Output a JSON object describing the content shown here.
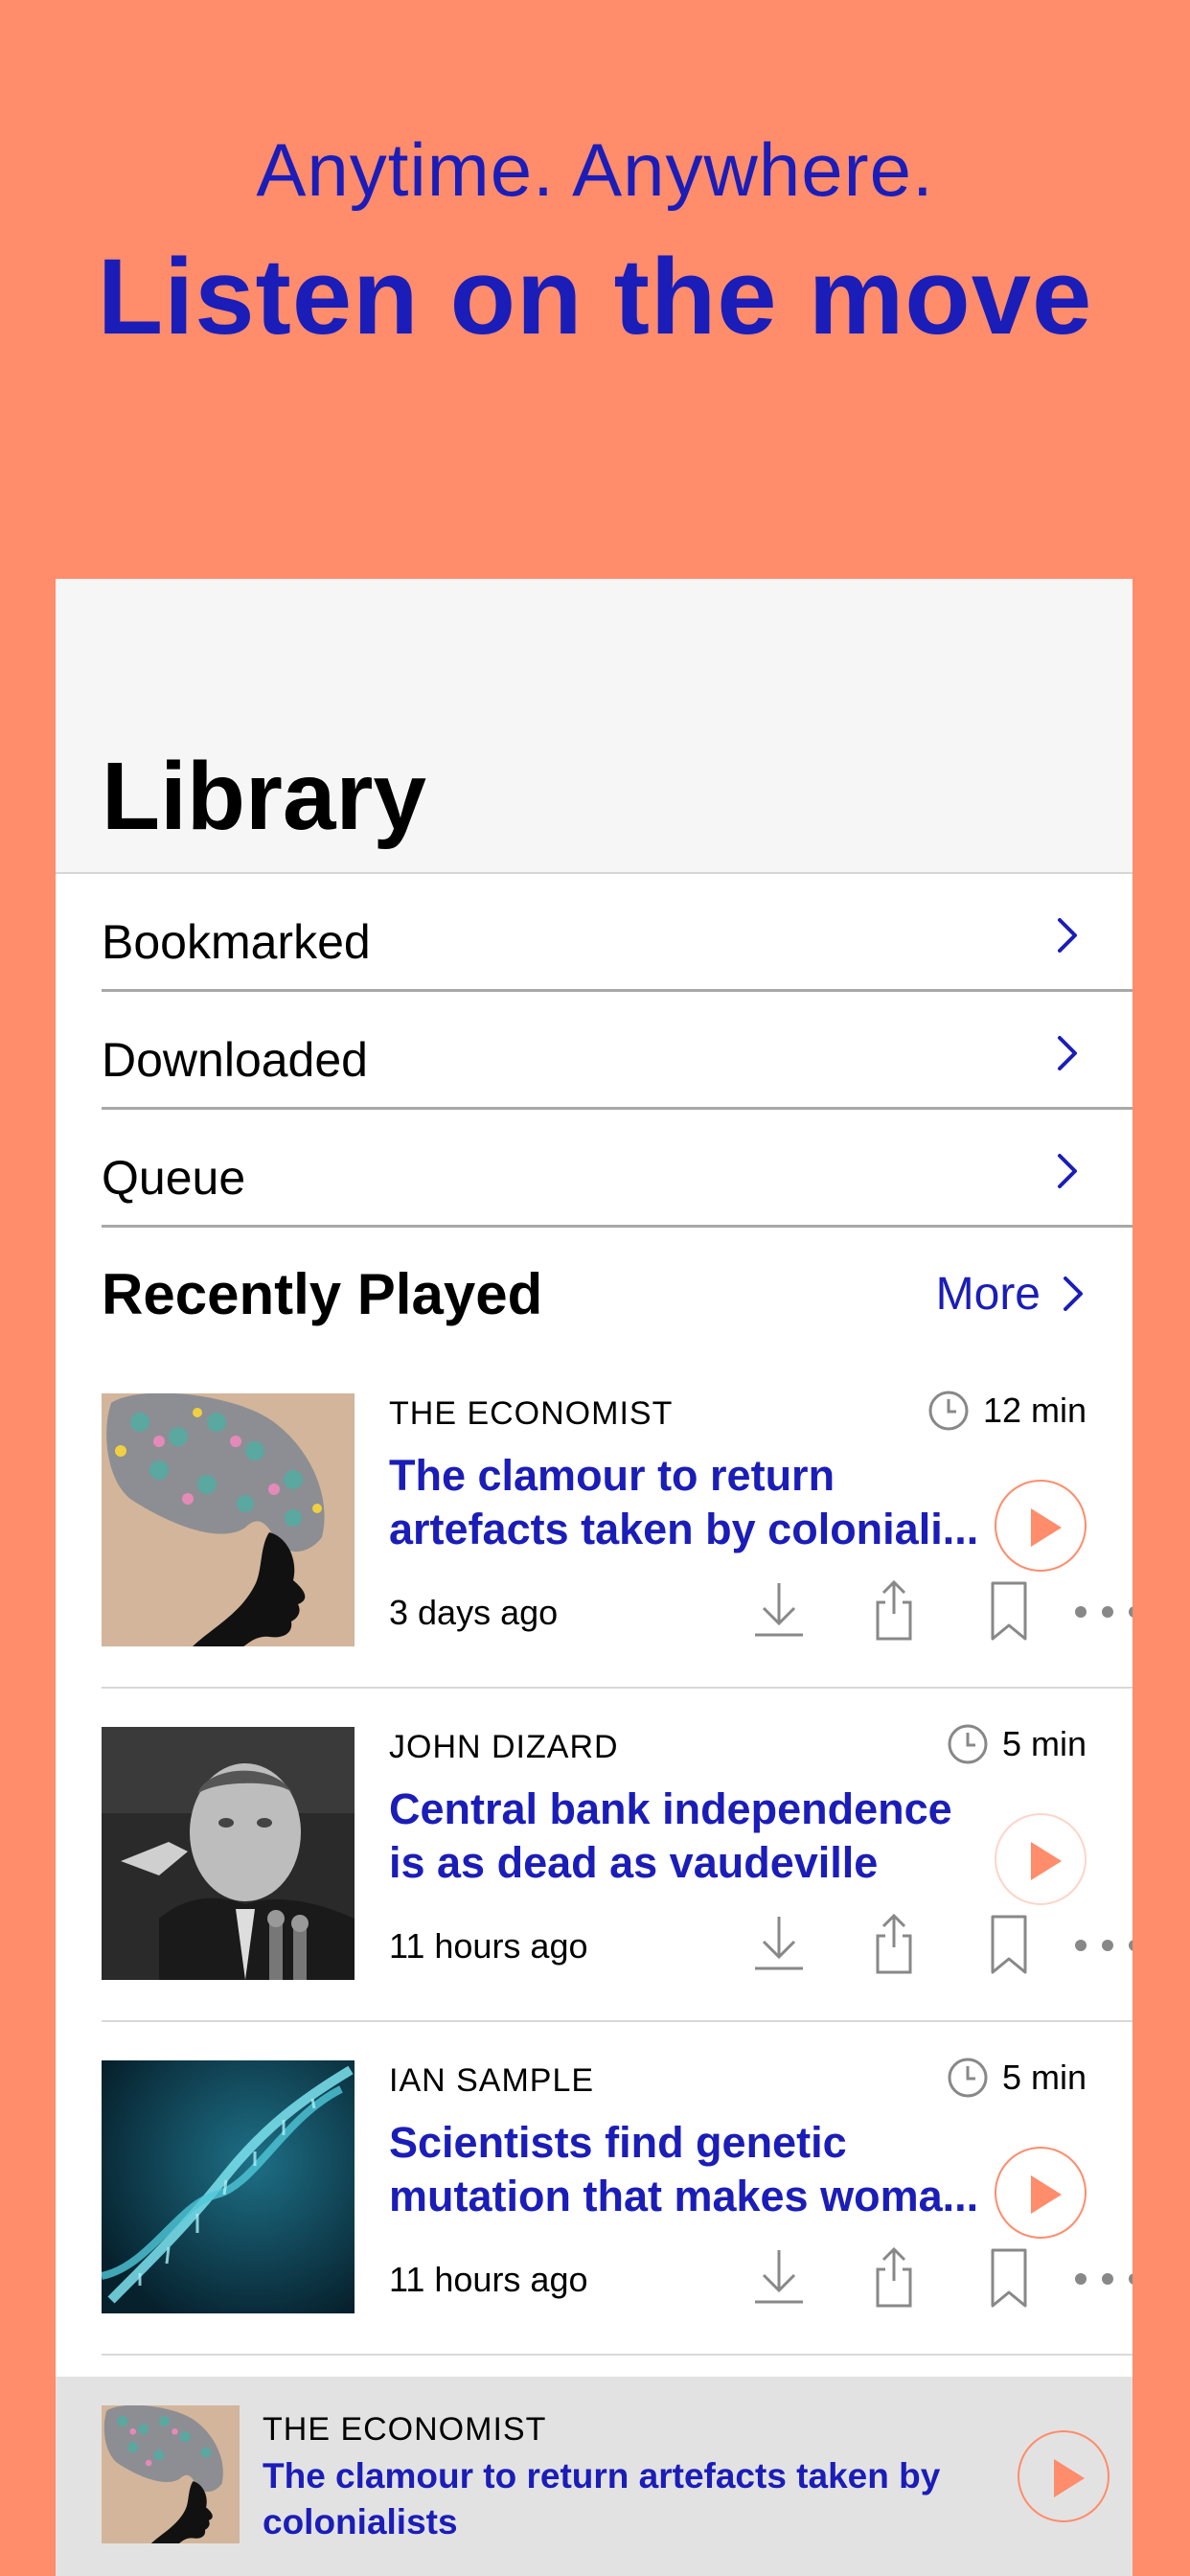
{
  "promo": {
    "line1": "Anytime. Anywhere.",
    "line2": "Listen on the move"
  },
  "library": {
    "title": "Library",
    "menu": [
      {
        "label": "Bookmarked"
      },
      {
        "label": "Downloaded"
      },
      {
        "label": "Queue"
      }
    ]
  },
  "recent": {
    "title": "Recently Played",
    "more_label": "More",
    "episodes": [
      {
        "source": "THE ECONOMIST",
        "duration": "12 min",
        "title_line1": "The clamour to return",
        "title_line2": "artefacts taken by coloniali...",
        "posted": "3 days ago",
        "thumb": "silhouette-headwrap"
      },
      {
        "source": "JOHN DIZARD",
        "duration": "5 min",
        "title_line1": "Central bank independence",
        "title_line2": "is as dead as vaudeville",
        "posted": "11 hours ago",
        "thumb": "bw-portrait"
      },
      {
        "source": "IAN SAMPLE",
        "duration": "5 min",
        "title_line1": "Scientists find genetic",
        "title_line2": "mutation that makes woma...",
        "posted": "11 hours ago",
        "thumb": "dna-helix"
      }
    ]
  },
  "mini_player": {
    "source": "THE ECONOMIST",
    "title": "The clamour to return artefacts taken by colonialists"
  },
  "colors": {
    "background": "#FF8C6B",
    "accent": "#1B1DB8",
    "play": "#FF8C6B"
  },
  "icons": [
    "chevron-right-icon",
    "clock-icon",
    "play-icon",
    "download-icon",
    "share-icon",
    "bookmark-icon",
    "more-icon"
  ]
}
